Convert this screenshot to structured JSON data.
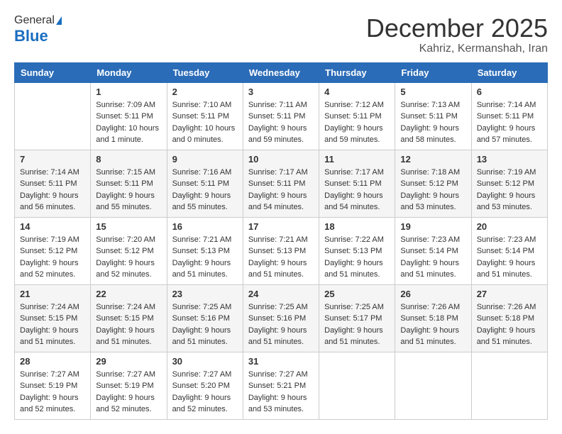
{
  "logo": {
    "general": "General",
    "blue": "Blue"
  },
  "title": {
    "month": "December 2025",
    "location": "Kahriz, Kermanshah, Iran"
  },
  "weekdays": [
    "Sunday",
    "Monday",
    "Tuesday",
    "Wednesday",
    "Thursday",
    "Friday",
    "Saturday"
  ],
  "weeks": [
    [
      {
        "day": "",
        "sunrise": "",
        "sunset": "",
        "daylight": ""
      },
      {
        "day": "1",
        "sunrise": "Sunrise: 7:09 AM",
        "sunset": "Sunset: 5:11 PM",
        "daylight": "Daylight: 10 hours and 1 minute."
      },
      {
        "day": "2",
        "sunrise": "Sunrise: 7:10 AM",
        "sunset": "Sunset: 5:11 PM",
        "daylight": "Daylight: 10 hours and 0 minutes."
      },
      {
        "day": "3",
        "sunrise": "Sunrise: 7:11 AM",
        "sunset": "Sunset: 5:11 PM",
        "daylight": "Daylight: 9 hours and 59 minutes."
      },
      {
        "day": "4",
        "sunrise": "Sunrise: 7:12 AM",
        "sunset": "Sunset: 5:11 PM",
        "daylight": "Daylight: 9 hours and 59 minutes."
      },
      {
        "day": "5",
        "sunrise": "Sunrise: 7:13 AM",
        "sunset": "Sunset: 5:11 PM",
        "daylight": "Daylight: 9 hours and 58 minutes."
      },
      {
        "day": "6",
        "sunrise": "Sunrise: 7:14 AM",
        "sunset": "Sunset: 5:11 PM",
        "daylight": "Daylight: 9 hours and 57 minutes."
      }
    ],
    [
      {
        "day": "7",
        "sunrise": "Sunrise: 7:14 AM",
        "sunset": "Sunset: 5:11 PM",
        "daylight": "Daylight: 9 hours and 56 minutes."
      },
      {
        "day": "8",
        "sunrise": "Sunrise: 7:15 AM",
        "sunset": "Sunset: 5:11 PM",
        "daylight": "Daylight: 9 hours and 55 minutes."
      },
      {
        "day": "9",
        "sunrise": "Sunrise: 7:16 AM",
        "sunset": "Sunset: 5:11 PM",
        "daylight": "Daylight: 9 hours and 55 minutes."
      },
      {
        "day": "10",
        "sunrise": "Sunrise: 7:17 AM",
        "sunset": "Sunset: 5:11 PM",
        "daylight": "Daylight: 9 hours and 54 minutes."
      },
      {
        "day": "11",
        "sunrise": "Sunrise: 7:17 AM",
        "sunset": "Sunset: 5:11 PM",
        "daylight": "Daylight: 9 hours and 54 minutes."
      },
      {
        "day": "12",
        "sunrise": "Sunrise: 7:18 AM",
        "sunset": "Sunset: 5:12 PM",
        "daylight": "Daylight: 9 hours and 53 minutes."
      },
      {
        "day": "13",
        "sunrise": "Sunrise: 7:19 AM",
        "sunset": "Sunset: 5:12 PM",
        "daylight": "Daylight: 9 hours and 53 minutes."
      }
    ],
    [
      {
        "day": "14",
        "sunrise": "Sunrise: 7:19 AM",
        "sunset": "Sunset: 5:12 PM",
        "daylight": "Daylight: 9 hours and 52 minutes."
      },
      {
        "day": "15",
        "sunrise": "Sunrise: 7:20 AM",
        "sunset": "Sunset: 5:12 PM",
        "daylight": "Daylight: 9 hours and 52 minutes."
      },
      {
        "day": "16",
        "sunrise": "Sunrise: 7:21 AM",
        "sunset": "Sunset: 5:13 PM",
        "daylight": "Daylight: 9 hours and 51 minutes."
      },
      {
        "day": "17",
        "sunrise": "Sunrise: 7:21 AM",
        "sunset": "Sunset: 5:13 PM",
        "daylight": "Daylight: 9 hours and 51 minutes."
      },
      {
        "day": "18",
        "sunrise": "Sunrise: 7:22 AM",
        "sunset": "Sunset: 5:13 PM",
        "daylight": "Daylight: 9 hours and 51 minutes."
      },
      {
        "day": "19",
        "sunrise": "Sunrise: 7:23 AM",
        "sunset": "Sunset: 5:14 PM",
        "daylight": "Daylight: 9 hours and 51 minutes."
      },
      {
        "day": "20",
        "sunrise": "Sunrise: 7:23 AM",
        "sunset": "Sunset: 5:14 PM",
        "daylight": "Daylight: 9 hours and 51 minutes."
      }
    ],
    [
      {
        "day": "21",
        "sunrise": "Sunrise: 7:24 AM",
        "sunset": "Sunset: 5:15 PM",
        "daylight": "Daylight: 9 hours and 51 minutes."
      },
      {
        "day": "22",
        "sunrise": "Sunrise: 7:24 AM",
        "sunset": "Sunset: 5:15 PM",
        "daylight": "Daylight: 9 hours and 51 minutes."
      },
      {
        "day": "23",
        "sunrise": "Sunrise: 7:25 AM",
        "sunset": "Sunset: 5:16 PM",
        "daylight": "Daylight: 9 hours and 51 minutes."
      },
      {
        "day": "24",
        "sunrise": "Sunrise: 7:25 AM",
        "sunset": "Sunset: 5:16 PM",
        "daylight": "Daylight: 9 hours and 51 minutes."
      },
      {
        "day": "25",
        "sunrise": "Sunrise: 7:25 AM",
        "sunset": "Sunset: 5:17 PM",
        "daylight": "Daylight: 9 hours and 51 minutes."
      },
      {
        "day": "26",
        "sunrise": "Sunrise: 7:26 AM",
        "sunset": "Sunset: 5:18 PM",
        "daylight": "Daylight: 9 hours and 51 minutes."
      },
      {
        "day": "27",
        "sunrise": "Sunrise: 7:26 AM",
        "sunset": "Sunset: 5:18 PM",
        "daylight": "Daylight: 9 hours and 51 minutes."
      }
    ],
    [
      {
        "day": "28",
        "sunrise": "Sunrise: 7:27 AM",
        "sunset": "Sunset: 5:19 PM",
        "daylight": "Daylight: 9 hours and 52 minutes."
      },
      {
        "day": "29",
        "sunrise": "Sunrise: 7:27 AM",
        "sunset": "Sunset: 5:19 PM",
        "daylight": "Daylight: 9 hours and 52 minutes."
      },
      {
        "day": "30",
        "sunrise": "Sunrise: 7:27 AM",
        "sunset": "Sunset: 5:20 PM",
        "daylight": "Daylight: 9 hours and 52 minutes."
      },
      {
        "day": "31",
        "sunrise": "Sunrise: 7:27 AM",
        "sunset": "Sunset: 5:21 PM",
        "daylight": "Daylight: 9 hours and 53 minutes."
      },
      {
        "day": "",
        "sunrise": "",
        "sunset": "",
        "daylight": ""
      },
      {
        "day": "",
        "sunrise": "",
        "sunset": "",
        "daylight": ""
      },
      {
        "day": "",
        "sunrise": "",
        "sunset": "",
        "daylight": ""
      }
    ]
  ]
}
